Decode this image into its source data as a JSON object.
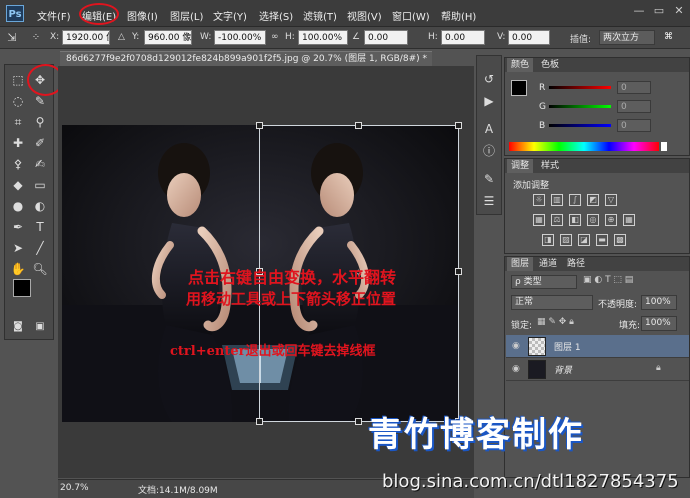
{
  "app": {
    "logo": "Ps"
  },
  "menu": [
    "文件(F)",
    "编辑(E)",
    "图像(I)",
    "图层(L)",
    "文字(Y)",
    "选择(S)",
    "滤镜(T)",
    "视图(V)",
    "窗口(W)",
    "帮助(H)"
  ],
  "window_controls": [
    "—",
    "▭",
    "✕"
  ],
  "options": {
    "x_label": "X:",
    "x_value": "1920.00 像",
    "y_label": "Y:",
    "y_value": "960.00 像",
    "w_label": "W:",
    "w_value": "-100.00%",
    "h_label": "H:",
    "h_value": "100.00%",
    "angle_value": "0.00",
    "hskew_label": "H:",
    "hskew_value": "0.00",
    "vskew_label": "V:",
    "vskew_value": "0.00",
    "interp_label": "插值:",
    "interp_value": "两次立方"
  },
  "document": {
    "tab_title": "86d6277f9e2f0708d129012fe824b899a901f2f5.jpg @ 20.7% (图层 1, RGB/8#) *",
    "close": "✕"
  },
  "status": {
    "zoom": "20.7%",
    "doc_info": "文档:14.1M/8.09M"
  },
  "overlay": {
    "line1": "点击右键自由变换，水平翻转",
    "line2": "用移动工具或上下箭头移正位置",
    "line3": "ctrl+enter退出或回车键去掉线框",
    "watermark": "青竹博客制作",
    "blog": "blog.sina.com.cn/dtl1827854375"
  },
  "color_panel": {
    "tabs": [
      "颜色",
      "色板"
    ],
    "channels": [
      "R",
      "G",
      "B"
    ],
    "values": [
      "0",
      "0",
      "0"
    ]
  },
  "adjust_panel": {
    "tabs": [
      "调整",
      "样式"
    ],
    "add_label": "添加调整"
  },
  "layers_panel": {
    "tabs": [
      "图层",
      "通道",
      "路径"
    ],
    "kind_label": "ρ 类型",
    "blend_mode": "正常",
    "opacity_label": "不透明度:",
    "opacity_value": "100%",
    "lock_label": "锁定:",
    "fill_label": "填充:",
    "fill_value": "100%",
    "layers": [
      {
        "name": "图层 1",
        "selected": true
      },
      {
        "name": "背景",
        "selected": false,
        "italic": true
      }
    ]
  },
  "colors": {
    "accent_red": "#e0141e",
    "layer_selected": "#5a6f8c"
  }
}
